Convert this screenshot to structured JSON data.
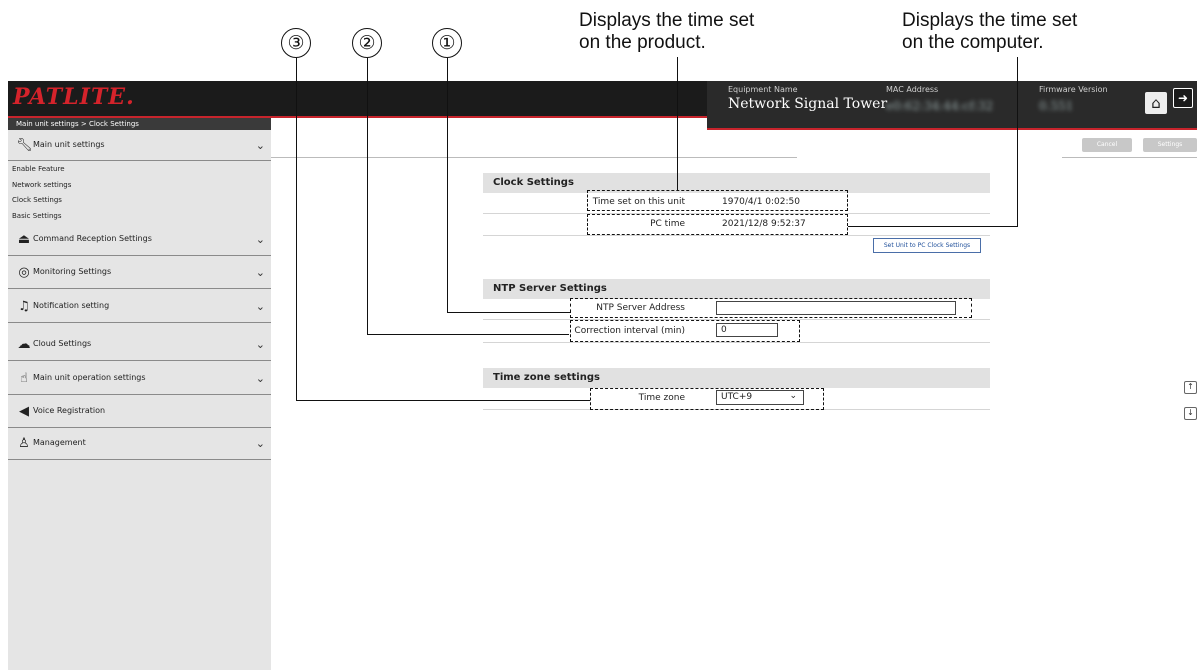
{
  "annotations": {
    "caption_product": [
      "Displays the time set",
      "on the product."
    ],
    "caption_computer": [
      "Displays the time set",
      "on the computer."
    ],
    "markers": [
      "③",
      "②",
      "①"
    ]
  },
  "header": {
    "logo": "PATLITE.",
    "breadcrumb": "Main unit settings > Clock Settings",
    "equipment_name_label": "Equipment Name",
    "equipment_name": "Network Signal Tower",
    "mac_label": "MAC Address",
    "mac_value": "e0:62:34:44:cf:32",
    "firmware_label": "Firmware Version",
    "firmware_value": "0.551",
    "home_icon": "home-icon",
    "logout_icon": "logout-icon"
  },
  "toolbar": {
    "cancel": "Cancel",
    "settings": "Settings"
  },
  "sidebar": {
    "main_unit_settings": "Main unit settings",
    "sub_items": [
      "Enable Feature",
      "Network settings",
      "Clock Settings",
      "Basic Settings"
    ],
    "items": [
      "Command Reception Settings",
      "Monitoring Settings",
      "Notification setting",
      "Cloud Settings",
      "Main unit operation settings",
      "Voice Registration",
      "Management"
    ]
  },
  "clock": {
    "title": "Clock Settings",
    "unit_time_label": "Time set on this unit",
    "unit_time_value": "1970/4/1 0:02:50",
    "pc_time_label": "PC time",
    "pc_time_value": "2021/12/8 9:52:37",
    "sync_button": "Set Unit to PC Clock Settings"
  },
  "ntp": {
    "title": "NTP Server Settings",
    "address_label": "NTP Server Address",
    "address_value": "",
    "interval_label": "Correction interval (min)",
    "interval_value": "0"
  },
  "timezone": {
    "title": "Time zone settings",
    "label": "Time zone",
    "value": "UTC+9"
  },
  "scroll": {
    "up": "↑",
    "down": "↓"
  }
}
